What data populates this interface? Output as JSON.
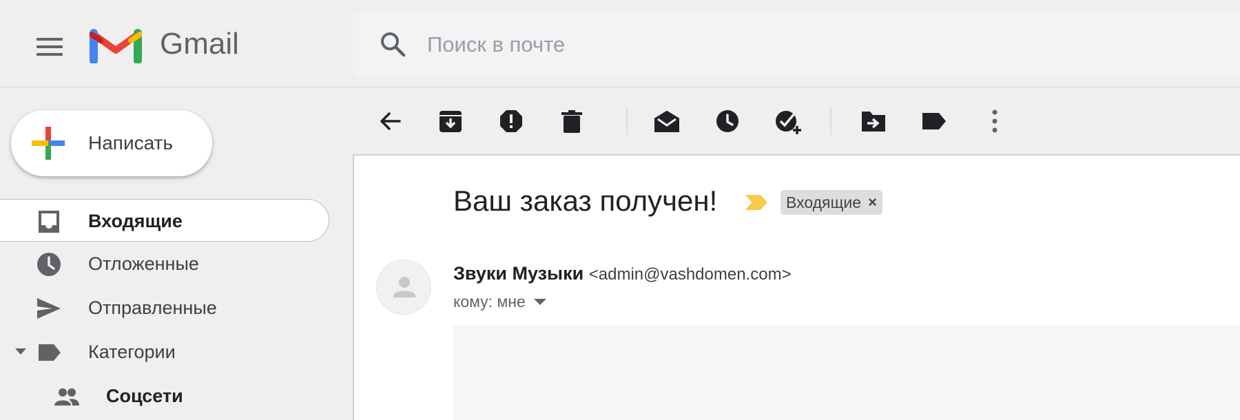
{
  "app": {
    "name": "Gmail"
  },
  "search": {
    "placeholder": "Поиск в почте",
    "value": ""
  },
  "compose": {
    "label": "Написать"
  },
  "sidebar": {
    "items": [
      {
        "label": "Входящие",
        "icon": "inbox-icon",
        "active": true
      },
      {
        "label": "Отложенные",
        "icon": "clock-icon"
      },
      {
        "label": "Отправленные",
        "icon": "send-icon"
      },
      {
        "label": "Категории",
        "icon": "label-icon",
        "expanded": true
      }
    ],
    "subitems": [
      {
        "label": "Соцсети",
        "icon": "people-icon",
        "bold": true
      }
    ]
  },
  "toolbar": {
    "icons": [
      "back-arrow-icon",
      "archive-icon",
      "report-spam-icon",
      "delete-icon",
      "mark-unread-icon",
      "snooze-icon",
      "add-task-icon",
      "move-to-icon",
      "label-icon",
      "more-vertical-icon"
    ]
  },
  "email": {
    "subject": "Ваш заказ получен!",
    "importance_color": "#f7cb4d",
    "label": "Входящие",
    "label_remove": "×",
    "sender_name": "Звуки Музыки",
    "sender_email": "<admin@vashdomen.com>",
    "recipient": "кому: мне"
  },
  "colors": {
    "gmail_red": "#ea4335",
    "gmail_blue": "#4285f4",
    "gmail_green": "#34a853",
    "gmail_yellow": "#fbbc04",
    "icon_gray": "#5f6368"
  }
}
